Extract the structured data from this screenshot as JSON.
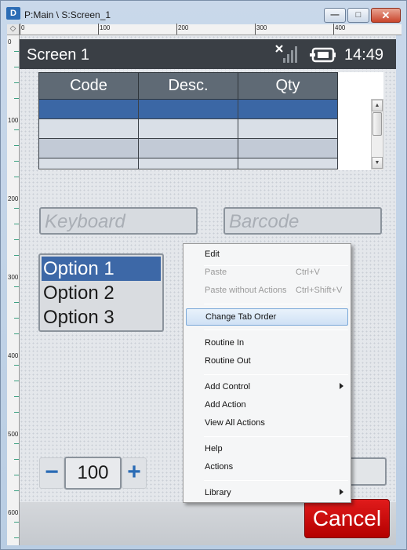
{
  "window": {
    "icon_label": "D",
    "title": "P:Main \\ S:Screen_1",
    "min_glyph": "—",
    "max_glyph": "□",
    "close_glyph": "✕"
  },
  "rulers": {
    "top": [
      "0",
      "100",
      "200",
      "300",
      "400"
    ],
    "left": [
      "0",
      "100",
      "200",
      "300",
      "400",
      "500",
      "600"
    ]
  },
  "device": {
    "screen_title": "Screen 1",
    "time": "14:49",
    "signal_icon": "no-signal-icon",
    "battery_icon": "battery-charging-icon"
  },
  "grid": {
    "columns": [
      "Code",
      "Desc.",
      "Qty"
    ]
  },
  "inputs": {
    "keyboard_placeholder": "Keyboard",
    "barcode_placeholder": "Barcode"
  },
  "listbox": {
    "options": [
      "Option 1",
      "Option 2",
      "Option 3"
    ],
    "selected": "Option 1"
  },
  "stepper": {
    "minus": "−",
    "value": "100",
    "plus": "+"
  },
  "cancel_label": "Cancel",
  "context_menu": {
    "items": [
      {
        "label": "Edit",
        "shortcut": "",
        "disabled": false
      },
      {
        "label": "Paste",
        "shortcut": "Ctrl+V",
        "disabled": true
      },
      {
        "label": "Paste without Actions",
        "shortcut": "Ctrl+Shift+V",
        "disabled": true
      },
      {
        "label": "Change Tab Order",
        "shortcut": "",
        "disabled": false,
        "highlighted": true
      },
      {
        "label": "Routine In",
        "shortcut": "",
        "disabled": false
      },
      {
        "label": "Routine Out",
        "shortcut": "",
        "disabled": false
      },
      {
        "label": "Add Control",
        "shortcut": "",
        "disabled": false,
        "submenu": true
      },
      {
        "label": "Add Action",
        "shortcut": "",
        "disabled": false
      },
      {
        "label": "View All Actions",
        "shortcut": "",
        "disabled": false
      },
      {
        "label": "Help",
        "shortcut": "",
        "disabled": false
      },
      {
        "label": "Actions",
        "shortcut": "",
        "disabled": false
      },
      {
        "label": "Library",
        "shortcut": "",
        "disabled": false,
        "submenu": true
      }
    ]
  }
}
